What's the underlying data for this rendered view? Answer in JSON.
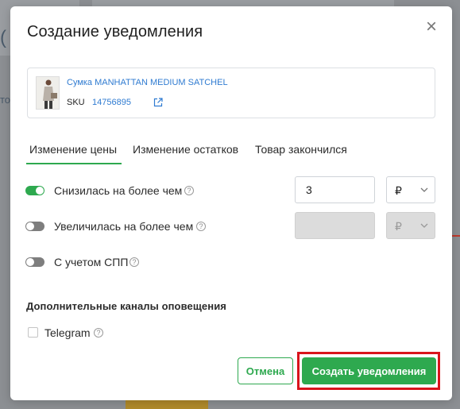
{
  "modal": {
    "title": "Создание уведомления",
    "close_symbol": "×"
  },
  "product": {
    "name": "Сумка MANHATTAN MEDIUM SATCHEL",
    "sku_label": "SKU",
    "sku_value": "14756895",
    "link_icon": "external-link-icon"
  },
  "tabs": [
    {
      "label": "Изменение цены",
      "active": true
    },
    {
      "label": "Изменение остатков",
      "active": false
    },
    {
      "label": "Товар закончился",
      "active": false
    }
  ],
  "options": {
    "decrease": {
      "label": "Снизилась на более чем",
      "enabled": true,
      "value": "3",
      "currency": "₽",
      "help": "?"
    },
    "increase": {
      "label": "Увеличилась на более чем",
      "enabled": false,
      "value": "",
      "currency": "₽",
      "help": "?"
    },
    "spp": {
      "label": "С учетом СПП",
      "enabled": false,
      "help": "?"
    }
  },
  "channels": {
    "title": "Дополнительные каналы оповещения",
    "telegram": {
      "label": "Telegram",
      "checked": false,
      "help": "?"
    }
  },
  "buttons": {
    "cancel": "Отмена",
    "create": "Создать уведомления"
  },
  "colors": {
    "accent": "#2ea94f",
    "link": "#2f7bd1",
    "highlight": "#d9141c"
  }
}
